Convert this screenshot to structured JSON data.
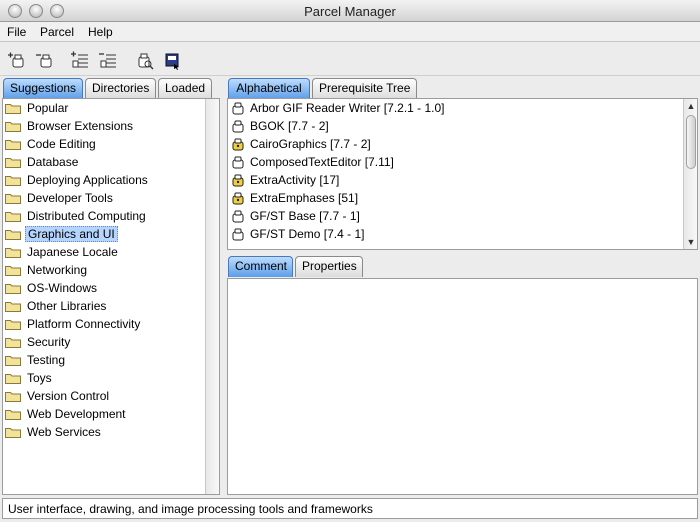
{
  "window": {
    "title": "Parcel Manager"
  },
  "menubar": {
    "items": [
      "File",
      "Parcel",
      "Help"
    ]
  },
  "toolbar": {
    "buttons": [
      {
        "icon": "load-parcel-icon"
      },
      {
        "icon": "unload-parcel-icon"
      },
      {
        "icon": "load-list-icon"
      },
      {
        "icon": "unload-list-icon"
      },
      {
        "icon": "browse-parcel-icon"
      },
      {
        "icon": "save-icon"
      }
    ]
  },
  "left_tabs": {
    "items": [
      "Suggestions",
      "Directories",
      "Loaded"
    ],
    "active": "Suggestions"
  },
  "categories": {
    "selected": "Graphics and UI",
    "items": [
      "Popular",
      "Browser Extensions",
      "Code Editing",
      "Database",
      "Deploying Applications",
      "Developer Tools",
      "Distributed Computing",
      "Graphics and UI",
      "Japanese Locale",
      "Networking",
      "OS-Windows",
      "Other Libraries",
      "Platform Connectivity",
      "Security",
      "Testing",
      "Toys",
      "Version Control",
      "Web Development",
      "Web Services"
    ]
  },
  "right_tabs": {
    "items": [
      "Alphabetical",
      "Prerequisite Tree"
    ],
    "active": "Alphabetical"
  },
  "parcels": {
    "items": [
      {
        "label": "Arbor GIF Reader Writer [7.2.1 - 1.0]",
        "locked": false
      },
      {
        "label": "BGOK [7.7 - 2]",
        "locked": false
      },
      {
        "label": "CairoGraphics [7.7 - 2]",
        "locked": true
      },
      {
        "label": "ComposedTextEditor [7.11]",
        "locked": false
      },
      {
        "label": "ExtraActivity [17]",
        "locked": true
      },
      {
        "label": "ExtraEmphases [51]",
        "locked": true
      },
      {
        "label": "GF/ST Base [7.7 - 1]",
        "locked": false
      },
      {
        "label": "GF/ST Demo [7.4 - 1]",
        "locked": false
      }
    ]
  },
  "detail_tabs": {
    "items": [
      "Comment",
      "Properties"
    ],
    "active": "Comment"
  },
  "status": {
    "text": "User interface, drawing, and image processing tools and frameworks"
  },
  "colors": {
    "tab_active": "#5c9ee8",
    "selection": "#b5d5ff",
    "folder": "#f3e29a"
  }
}
